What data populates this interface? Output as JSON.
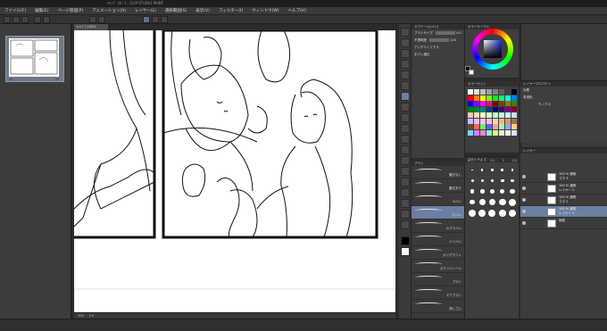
{
  "window": {
    "title": "ｸﾘｯﾌﾟ ｽﾀｼﾞｵ - CLIP STUDIO PAINT"
  },
  "menu": [
    "ファイル(F)",
    "編集(E)",
    "ページ管理(P)",
    "アニメーション(A)",
    "レイヤー(L)",
    "選択範囲(S)",
    "表示(V)",
    "フィルター(I)",
    "ウィンドウ(W)",
    "ヘルプ(H)"
  ],
  "navigator": {
    "page_labels": [
      "3P",
      "4P"
    ]
  },
  "canvas": {
    "tab_label": "ｷｬﾝﾊﾞｽ 100%"
  },
  "subtool": {
    "header": "サブツール[ペン]",
    "brush_size_label": "ブラシサイズ",
    "brush_size_value": "4.0",
    "opacity_label": "不透明度",
    "opacity_value": "100",
    "aa_label": "アンチエイリアス",
    "stabilization_label": "手ブレ補正"
  },
  "brushes": {
    "header": "ブラシ",
    "items": [
      "筆圧なし",
      "筆圧あり",
      "Gペン",
      "丸ペン",
      "カブラペン",
      "ミリペン",
      "カリグラフィ",
      "スクリントーン",
      "ブラシ",
      "エアブラシ",
      "消しゴム"
    ],
    "selected_index": 3
  },
  "color": {
    "header": "カラーサークル",
    "accent": "#1a2bd9"
  },
  "palette": {
    "header": "カラーセット",
    "swatches": [
      "#ffffff",
      "#e0e0e0",
      "#c0c0c0",
      "#a0a0a0",
      "#808080",
      "#606060",
      "#404040",
      "#000000",
      "#ff0000",
      "#ff8000",
      "#ffff00",
      "#80ff00",
      "#00ff00",
      "#00ff80",
      "#00ffff",
      "#0080ff",
      "#0000ff",
      "#8000ff",
      "#ff00ff",
      "#ff0080",
      "#800000",
      "#804000",
      "#808000",
      "#408000",
      "#008000",
      "#008040",
      "#008080",
      "#004080",
      "#000080",
      "#400080",
      "#800080",
      "#800040",
      "#ffc0c0",
      "#ffe0c0",
      "#ffffc0",
      "#e0ffc0",
      "#c0ffc0",
      "#c0ffe0",
      "#c0ffff",
      "#c0e0ff",
      "#c0c0ff",
      "#e0c0ff",
      "#ffc0ff",
      "#ffc0e0",
      "#f4d3b8",
      "#e8b890",
      "#d49a6a",
      "#a0704a",
      "#6b4a30",
      "#ff6060",
      "#60ff60",
      "#6060ff",
      "#ffa0a0",
      "#a0ffa0",
      "#a0a0ff",
      "#ffd080",
      "#80d0ff",
      "#d080ff",
      "#ff80d0",
      "#80ffd0",
      "#d0ff80",
      "#ffe0e0",
      "#e0ffe0",
      "#e0e0ff"
    ]
  },
  "brush_size": {
    "header": "ブラシサイズ",
    "labels": [
      "0.7",
      "1",
      "1.5",
      "2",
      "2.5"
    ],
    "sizes": [
      0.7,
      1,
      1.5,
      2,
      2.5,
      3,
      4,
      5,
      6,
      7,
      8,
      10,
      12,
      15,
      17,
      20,
      25,
      30,
      40,
      50,
      60,
      70,
      80,
      100,
      120
    ]
  },
  "layer_property": {
    "header": "レイヤープロパティ",
    "effect_label": "効果",
    "color_label": "表現色",
    "color_value": "モノクロ"
  },
  "layers": {
    "header": "レイヤー",
    "rows": [
      {
        "name": "100 % 通常\nコマ 3",
        "selected": false
      },
      {
        "name": "100 % 通常\nレイヤー 2",
        "selected": false
      },
      {
        "name": "100 % 通常\nコマ 2",
        "selected": false
      },
      {
        "name": "100 % 通常\nレイヤー 1",
        "selected": true
      },
      {
        "name": "用紙",
        "selected": false
      }
    ]
  },
  "status": {
    "zoom": "100",
    "angle": "0.0"
  }
}
